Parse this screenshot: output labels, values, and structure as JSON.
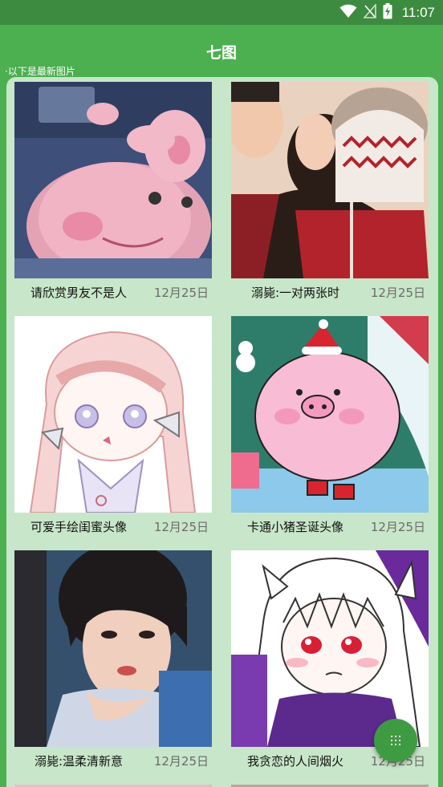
{
  "status_bar": {
    "time": "11:07",
    "icons": [
      "wifi-icon",
      "signal-off-icon",
      "battery-charging-icon"
    ]
  },
  "app_bar": {
    "title": "七图"
  },
  "subtitle": "·以下是最新图片",
  "cards": [
    {
      "title": "请欣赏男友不是人",
      "date": "12月25日",
      "image": "pink-pig-toy-photo"
    },
    {
      "title": "溺毙:一对两张时",
      "date": "12月25日",
      "image": "couple-winter-photo"
    },
    {
      "title": "可爱手绘闺蜜头像",
      "date": "12月25日",
      "image": "hand-drawn-anime-girl"
    },
    {
      "title": "卡通小猪圣诞头像",
      "date": "12月25日",
      "image": "cartoon-christmas-pig"
    },
    {
      "title": "溺毙:温柔清新意",
      "date": "12月25日",
      "image": "girl-portrait-photo"
    },
    {
      "title": "我贪恋的人间烟火",
      "date": "12月25日",
      "image": "anime-girl-purple"
    }
  ],
  "fab": {
    "icon": "grid-dots-icon"
  },
  "colors": {
    "primary": "#4caf50",
    "status_bar": "#3d8b40",
    "panel": "#c8e6c9",
    "fab": "#3f9b42"
  }
}
